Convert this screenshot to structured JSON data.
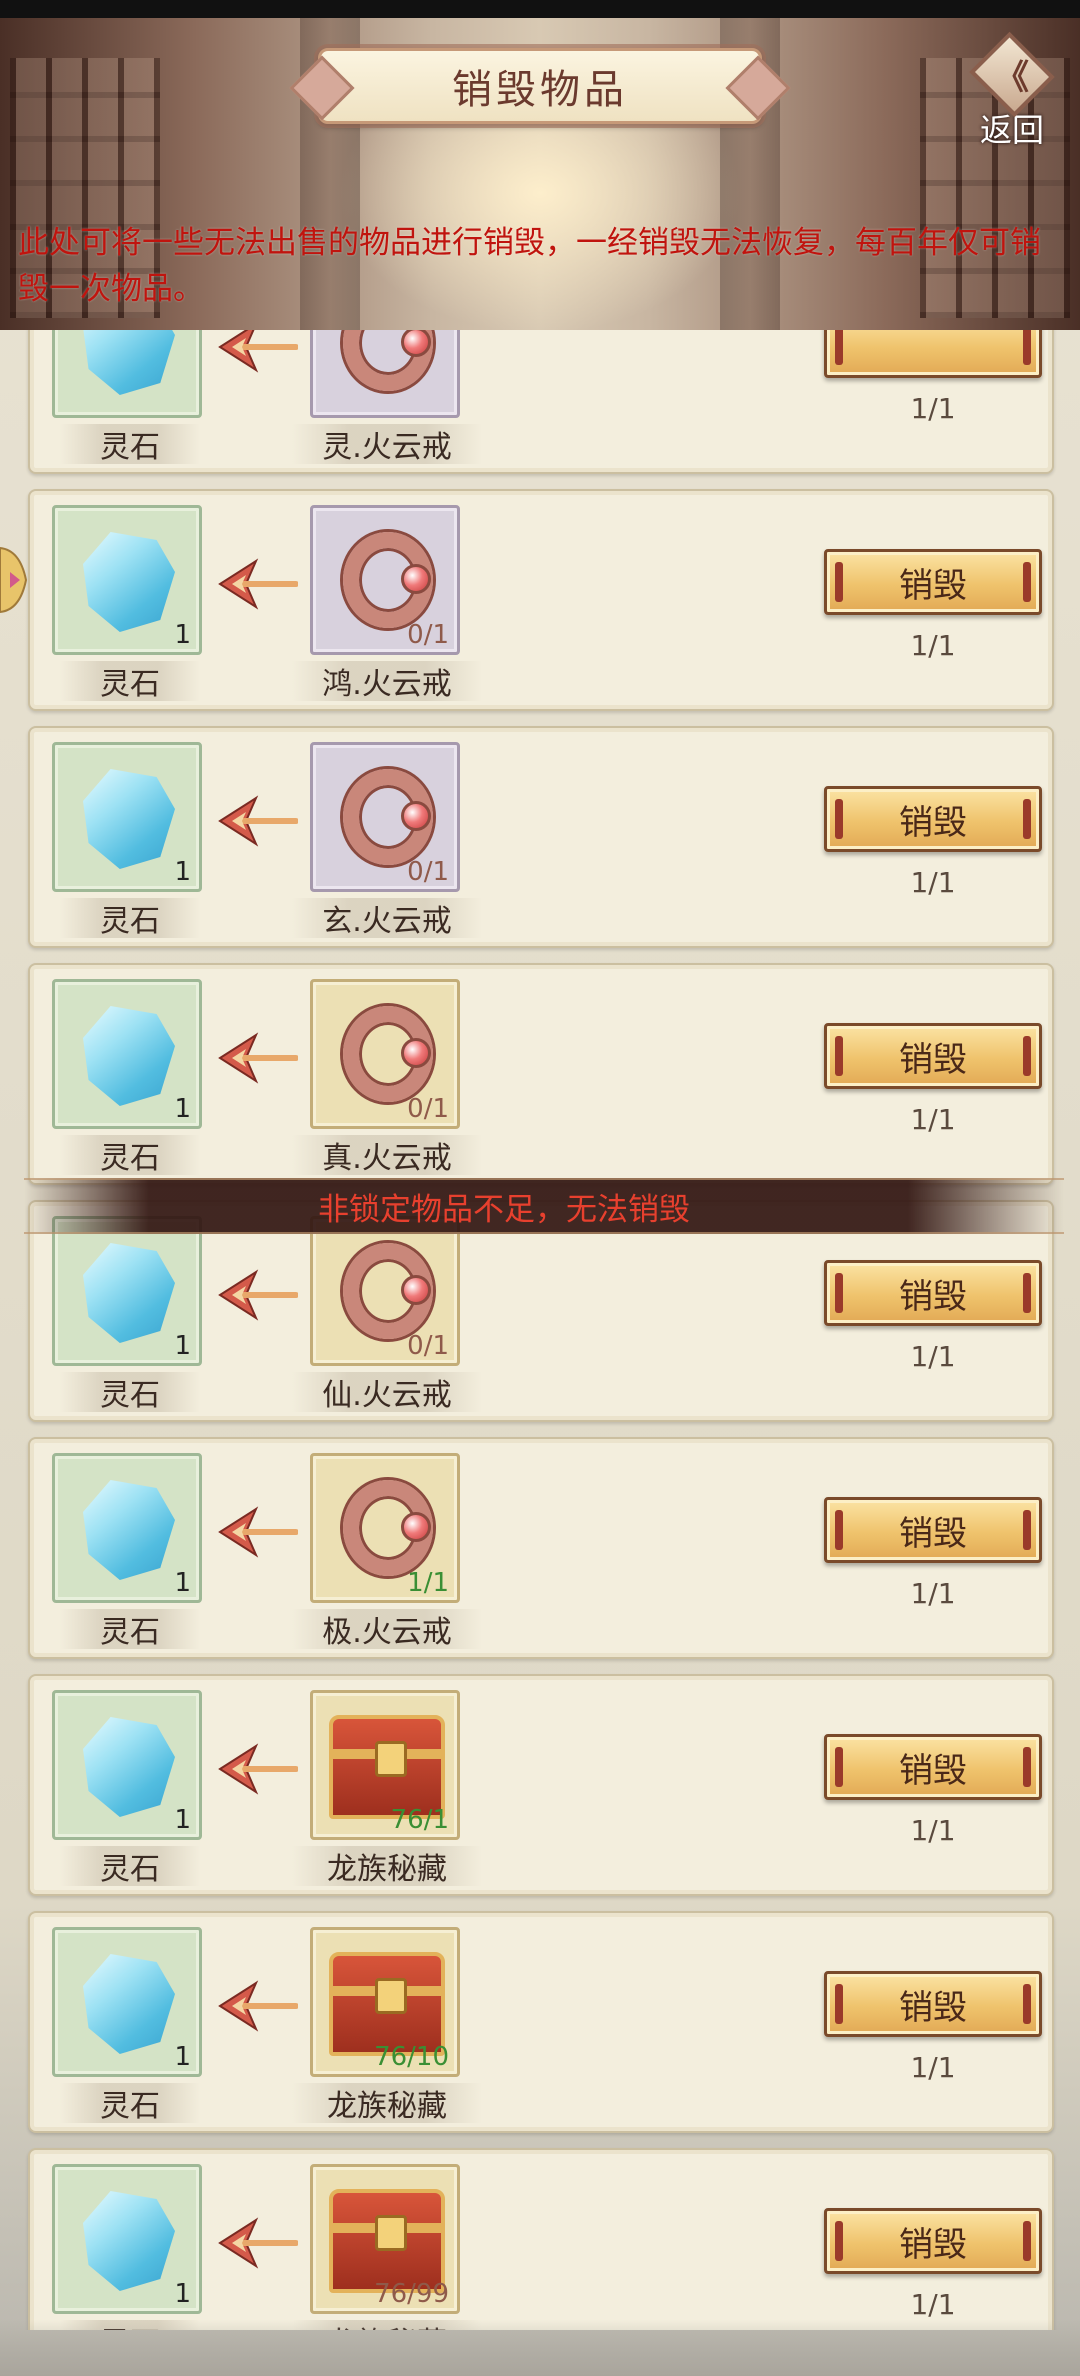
{
  "header": {
    "title": "销毁物品",
    "back_label": "返回",
    "back_glyph": "《"
  },
  "notice": "此处可将一些无法出售的物品进行销毁，一经销毁无法恢复，每百年仅可销毁一次物品。",
  "rows": [
    {
      "stone_label": "灵石",
      "stone_count": "",
      "item_label": "灵.火云戒",
      "item_count": "",
      "item_icon": "ring-icon",
      "item_frame": "purple",
      "count_color": "brown",
      "button_label": "",
      "progress": "1/1"
    },
    {
      "stone_label": "灵石",
      "stone_count": "1",
      "item_label": "鸿.火云戒",
      "item_count": "0/1",
      "item_icon": "ring-icon",
      "item_frame": "purple",
      "count_color": "brown",
      "button_label": "销毁",
      "progress": "1/1"
    },
    {
      "stone_label": "灵石",
      "stone_count": "1",
      "item_label": "玄.火云戒",
      "item_count": "0/1",
      "item_icon": "ring-icon",
      "item_frame": "purple",
      "count_color": "brown",
      "button_label": "销毁",
      "progress": "1/1"
    },
    {
      "stone_label": "灵石",
      "stone_count": "1",
      "item_label": "真.火云戒",
      "item_count": "0/1",
      "item_icon": "ring-icon",
      "item_frame": "gold",
      "count_color": "brown",
      "button_label": "销毁",
      "progress": "1/1"
    },
    {
      "stone_label": "灵石",
      "stone_count": "1",
      "item_label": "仙.火云戒",
      "item_count": "0/1",
      "item_icon": "ring-icon",
      "item_frame": "gold",
      "count_color": "brown",
      "button_label": "销毁",
      "progress": "1/1"
    },
    {
      "stone_label": "灵石",
      "stone_count": "1",
      "item_label": "极.火云戒",
      "item_count": "1/1",
      "item_icon": "ring-icon",
      "item_frame": "gold",
      "count_color": "green",
      "button_label": "销毁",
      "progress": "1/1"
    },
    {
      "stone_label": "灵石",
      "stone_count": "1",
      "item_label": "龙族秘藏",
      "item_count": "76/1",
      "item_icon": "chest-icon",
      "item_frame": "gold",
      "count_color": "green",
      "button_label": "销毁",
      "progress": "1/1"
    },
    {
      "stone_label": "灵石",
      "stone_count": "1",
      "item_label": "龙族秘藏",
      "item_count": "76/10",
      "item_icon": "chest-icon",
      "item_frame": "gold",
      "count_color": "green",
      "button_label": "销毁",
      "progress": "1/1"
    },
    {
      "stone_label": "灵石",
      "stone_count": "1",
      "item_label": "龙族秘藏",
      "item_count": "76/99",
      "item_icon": "chest-icon",
      "item_frame": "gold",
      "count_color": "brown",
      "button_label": "销毁",
      "progress": "1/1"
    }
  ],
  "toast": "非锁定物品不足，无法销毁",
  "colors": {
    "notice_text": "#c0140e",
    "toast_text": "#e8402e",
    "count_green": "#3a8f34",
    "count_brown": "#8f5a4a"
  }
}
